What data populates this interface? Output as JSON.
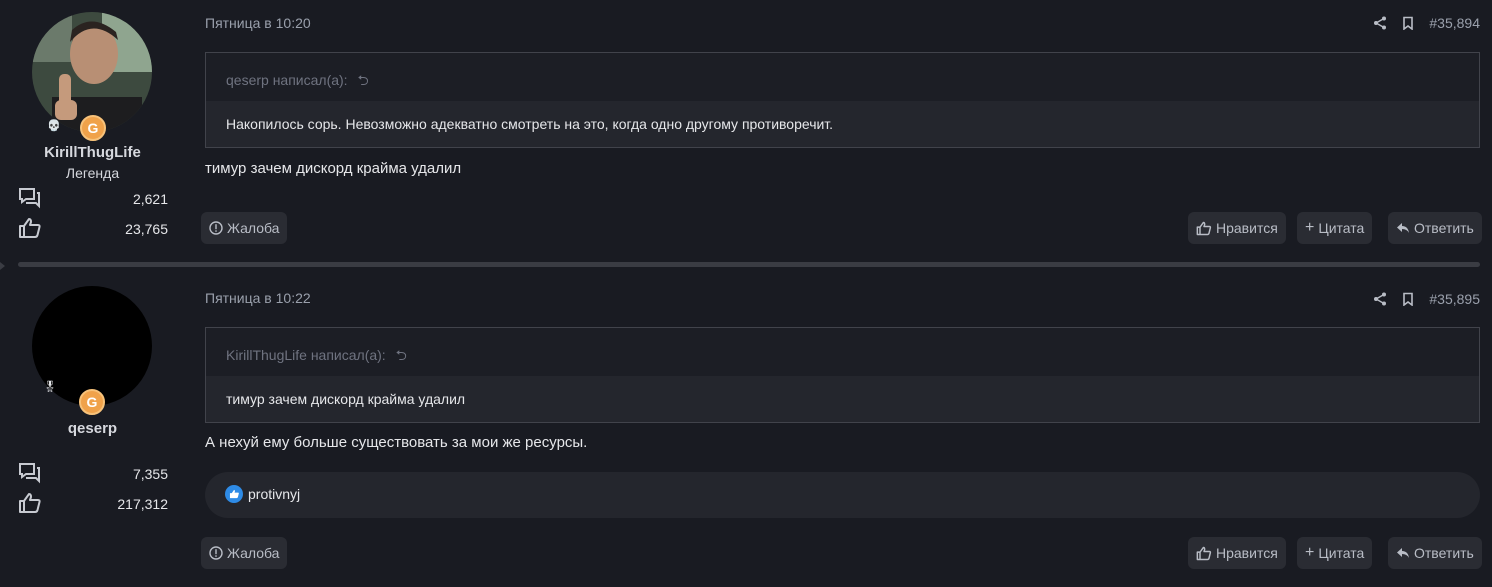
{
  "posts": [
    {
      "user": {
        "name": "KirillThugLife",
        "title": "Легенда",
        "messages_count": "2,621",
        "reactions_count": "23,765"
      },
      "date": "Пятница в 10:20",
      "post_number": "#35,894",
      "quote": {
        "author_line": "qeserp написал(а):",
        "text": "Накопилось сорь. Невозможно адекватно смотреть на это, когда одно другому противоречит."
      },
      "message": "тимур зачем дискорд крайма удалил",
      "buttons": {
        "report": "Жалоба",
        "like": "Нравится",
        "quote": "Цитата",
        "reply": "Ответить"
      }
    },
    {
      "user": {
        "name": "qeserp",
        "title": "",
        "messages_count": "7,355",
        "reactions_count": "217,312"
      },
      "date": "Пятница в 10:22",
      "post_number": "#35,895",
      "quote": {
        "author_line": "KirillThugLife написал(а):",
        "text": "тимур зачем дискорд крайма удалил"
      },
      "message": "А нехуй ему больше существовать за мои же ресурсы.",
      "reactions": {
        "users": "protivnyj"
      },
      "buttons": {
        "report": "Жалоба",
        "like": "Нравится",
        "quote": "Цитата",
        "reply": "Ответить"
      }
    }
  ],
  "icons": {
    "messages": "messages-icon",
    "reactions": "thumbs-up-icon",
    "share": "share-icon",
    "bookmark": "bookmark-icon",
    "report": "alert-circle-icon",
    "reply": "reply-arrow-icon"
  },
  "colors": {
    "background": "#191b22",
    "quote_body": "#24262d",
    "badge": "#f0a24a",
    "like_blue": "#2e8be6"
  }
}
